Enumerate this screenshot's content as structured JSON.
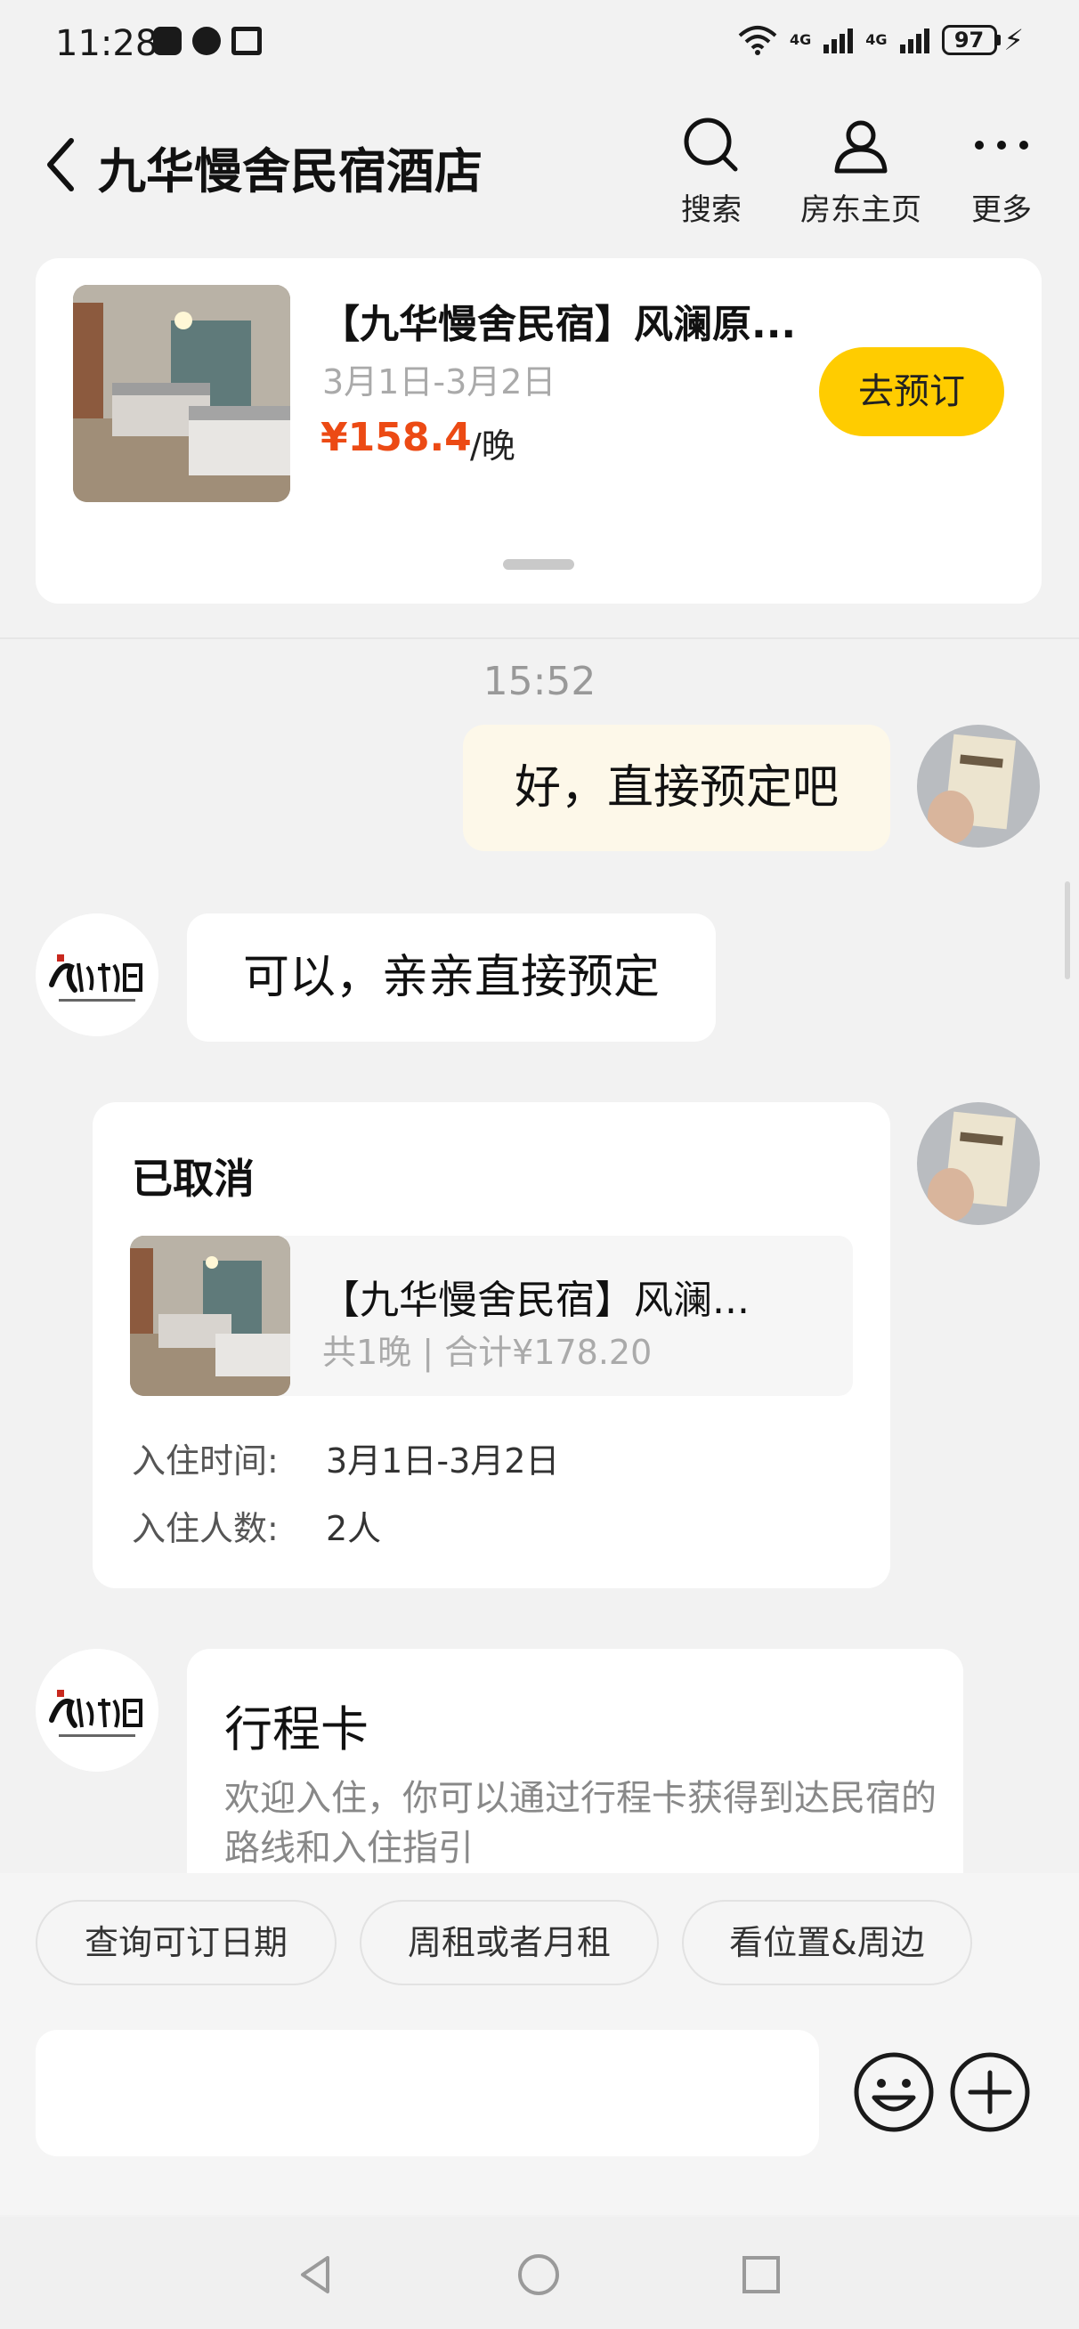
{
  "status_bar": {
    "time": "11:28",
    "network_1": "4G",
    "network_2": "4G",
    "battery": "97"
  },
  "header": {
    "title": "九华慢舍民宿酒店",
    "search_label": "搜索",
    "host_page_label": "房东主页",
    "more_label": "更多"
  },
  "listing": {
    "title": "【九华慢舍民宿】风澜原...",
    "dates": "3月1日-3月2日",
    "price": "¥158.4",
    "unit": "/晚",
    "book_label": "去预订"
  },
  "chat": {
    "timestamp": "15:52",
    "msg_out": "好，直接预定吧",
    "msg_in": "可以，亲亲直接预定",
    "order": {
      "status": "已取消",
      "title": "【九华慢舍民宿】风澜...",
      "summary": "共1晚 | 合计¥178.20",
      "checkin_label": "入住时间:",
      "checkin_value": "3月1日-3月2日",
      "guests_label": "入住人数:",
      "guests_value": "2人"
    },
    "trip_card": {
      "title": "行程卡",
      "desc": "欢迎入住，你可以通过行程卡获得到达民宿的路线和入住指引"
    }
  },
  "quick_replies": [
    "查询可订日期",
    "周租或者月租",
    "看位置&周边"
  ],
  "colors": {
    "accent_yellow": "#ffcc00",
    "price_orange": "#ec4a14",
    "outgoing_bubble": "#fdf8e9"
  }
}
